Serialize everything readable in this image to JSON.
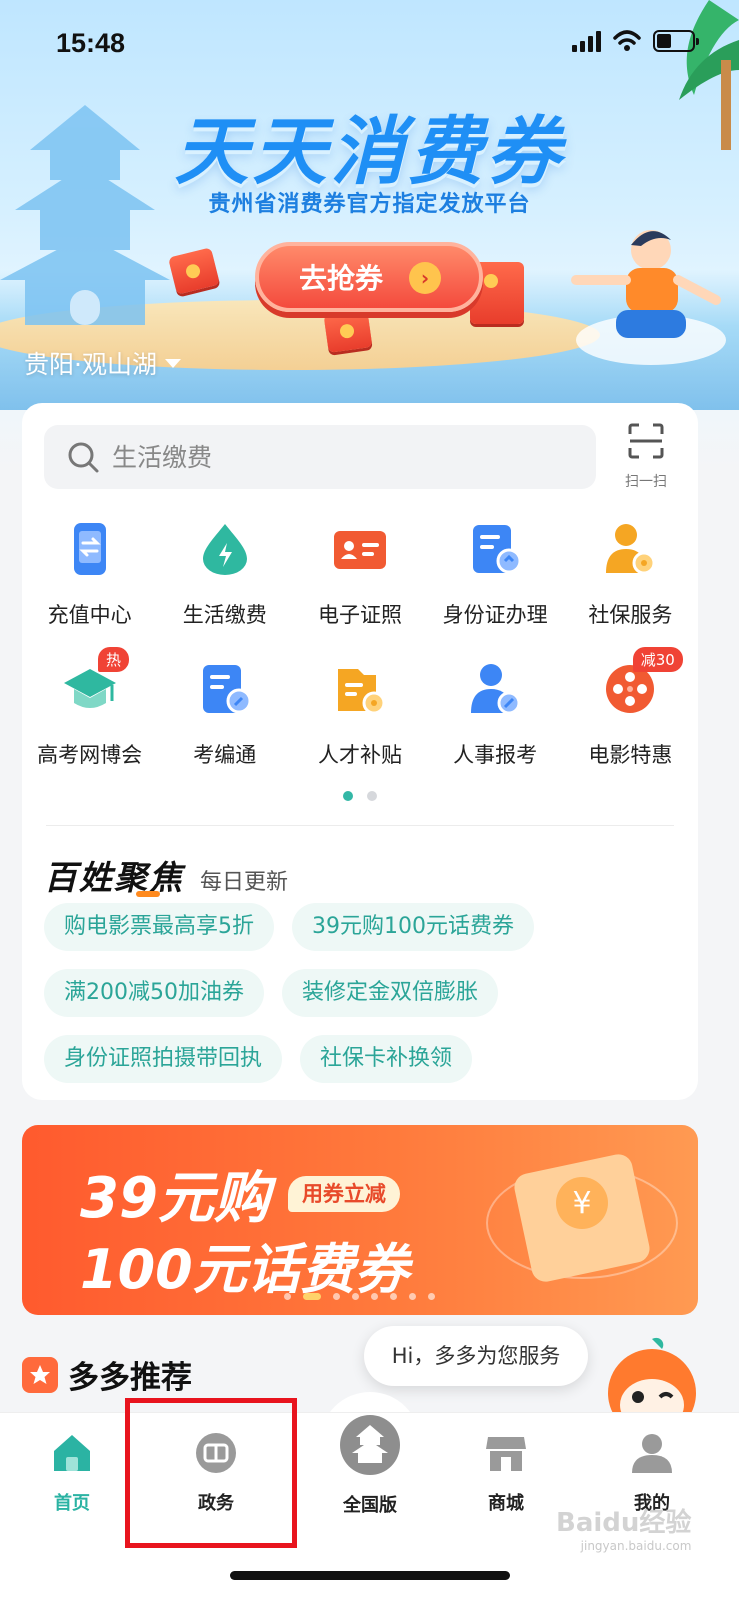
{
  "status_bar": {
    "time": "15:48"
  },
  "banner": {
    "title": "天天消费券",
    "subtitle": "贵州省消费券官方指定发放平台",
    "grab_button": "去抢券",
    "location": "贵阳·观山湖"
  },
  "search": {
    "placeholder": "生活缴费",
    "scan_label": "扫一扫"
  },
  "services": [
    {
      "label": "充值中心",
      "icon": "phone-recharge-icon",
      "color": "#3d86f5"
    },
    {
      "label": "生活缴费",
      "icon": "utility-drop-icon",
      "color": "#2fb8a0"
    },
    {
      "label": "电子证照",
      "icon": "id-card-icon",
      "color": "#f15a32"
    },
    {
      "label": "身份证办理",
      "icon": "id-form-icon",
      "color": "#3d86f5"
    },
    {
      "label": "社保服务",
      "icon": "social-security-icon",
      "color": "#f5a623"
    },
    {
      "label": "高考网博会",
      "icon": "graduation-cap-icon",
      "color": "#2fb8a0",
      "badge": "热"
    },
    {
      "label": "考编通",
      "icon": "exam-form-icon",
      "color": "#3d86f5"
    },
    {
      "label": "人才补贴",
      "icon": "talent-folder-icon",
      "color": "#f5a623"
    },
    {
      "label": "人事报考",
      "icon": "personnel-icon",
      "color": "#3d86f5"
    },
    {
      "label": "电影特惠",
      "icon": "film-reel-icon",
      "color": "#f15a32",
      "badge": "减30"
    }
  ],
  "focus": {
    "title": "百姓聚焦",
    "subtitle": "每日更新",
    "tags": [
      [
        "购电影票最高享5折",
        "39元购100元话费券"
      ],
      [
        "满200减50加油券",
        "装修定金双倍膨胀"
      ],
      [
        "身份证照拍摄带回执",
        "社保卡补换领"
      ]
    ]
  },
  "promo": {
    "line1": "39元购",
    "badge": "用券立减",
    "line2": "100元话费券"
  },
  "recommend": {
    "title": "多多推荐",
    "bubble": "Hi，多多为您服务"
  },
  "tabs": [
    {
      "label": "首页",
      "icon": "home-icon",
      "active": true
    },
    {
      "label": "政务",
      "icon": "gov-affairs-icon",
      "active": false
    },
    {
      "label": "全国版",
      "icon": "pagoda-icon",
      "active": false
    },
    {
      "label": "商城",
      "icon": "store-icon",
      "active": false
    },
    {
      "label": "我的",
      "icon": "profile-icon",
      "active": false
    }
  ],
  "watermark": {
    "brand": "Baidu经验",
    "url": "jingyan.baidu.com"
  },
  "colors": {
    "accent": "#2bb3a3",
    "brand_blue": "#1f8ff5",
    "promo_orange": "#ff5a2e",
    "highlight_red": "#e8141e"
  }
}
